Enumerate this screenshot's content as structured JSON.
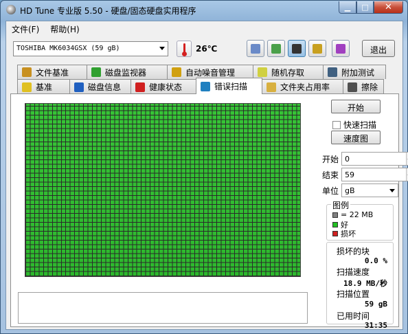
{
  "window": {
    "title": "HD Tune 专业版 5.50 - 硬盘/固态硬盘实用程序",
    "min": "▁",
    "max": "□",
    "close": "✕"
  },
  "menu": [
    {
      "label": "文件(F)"
    },
    {
      "label": "帮助(H)"
    }
  ],
  "toolbar": {
    "drive": "TOSHIBA MK6034GSX (59 gB)",
    "temperature": "26℃",
    "exit_label": "退出",
    "buttons": [
      {
        "icon": "copy-info-icon",
        "color": "#6a8ac8"
      },
      {
        "icon": "copy-text-icon",
        "color": "#4aa04a"
      },
      {
        "icon": "screenshot-icon",
        "color": "#333333"
      },
      {
        "icon": "options-icon",
        "color": "#c8a020"
      },
      {
        "icon": "save-icon",
        "color": "#a040c0"
      }
    ]
  },
  "tabs_row1": [
    {
      "label": "文件基准",
      "icon": "file-benchmark-icon",
      "color": "#c89020"
    },
    {
      "label": "磁盘监视器",
      "icon": "disk-monitor-icon",
      "color": "#30a030"
    },
    {
      "label": "自动噪音管理",
      "icon": "speaker-icon",
      "color": "#d0a010"
    },
    {
      "label": "随机存取",
      "icon": "random-access-icon",
      "color": "#d0d040"
    },
    {
      "label": "附加测试",
      "icon": "extra-tests-icon",
      "color": "#406080"
    }
  ],
  "tabs_row2": [
    {
      "label": "基准",
      "icon": "bulb-icon",
      "color": "#e0c020"
    },
    {
      "label": "磁盘信息",
      "icon": "info-icon",
      "color": "#2060c0"
    },
    {
      "label": "健康状态",
      "icon": "health-cross-icon",
      "color": "#d02020"
    },
    {
      "label": "错误扫描",
      "icon": "magnifier-icon",
      "color": "#2080c0",
      "active": true
    },
    {
      "label": "文件夹占用率",
      "icon": "folder-icon",
      "color": "#d8b040"
    },
    {
      "label": "擦除",
      "icon": "trash-icon",
      "color": "#505050"
    }
  ],
  "scan": {
    "start_button": "开始",
    "quick_scan": "快速扫描",
    "quick_scan_checked": false,
    "map_button": "速度图",
    "start_label": "开始",
    "start_value": "0",
    "end_label": "结束",
    "end_value": "59",
    "unit_label": "单位",
    "unit_value": "gB",
    "block_progress": 1.0
  },
  "legend": {
    "title": "图例",
    "items": [
      {
        "text": "= 22 MB",
        "color": "#808080"
      },
      {
        "text": "好",
        "color": "#22c022"
      },
      {
        "text": "损坏",
        "color": "#d02020"
      }
    ]
  },
  "stats": {
    "damaged_label": "损坏的块",
    "damaged_value": "0.0 %",
    "speed_label": "扫描速度",
    "speed_value": "18.9 MB/秒",
    "position_label": "扫描位置",
    "position_value": "59 gB",
    "elapsed_label": "已用时间",
    "elapsed_value": "31:35"
  }
}
